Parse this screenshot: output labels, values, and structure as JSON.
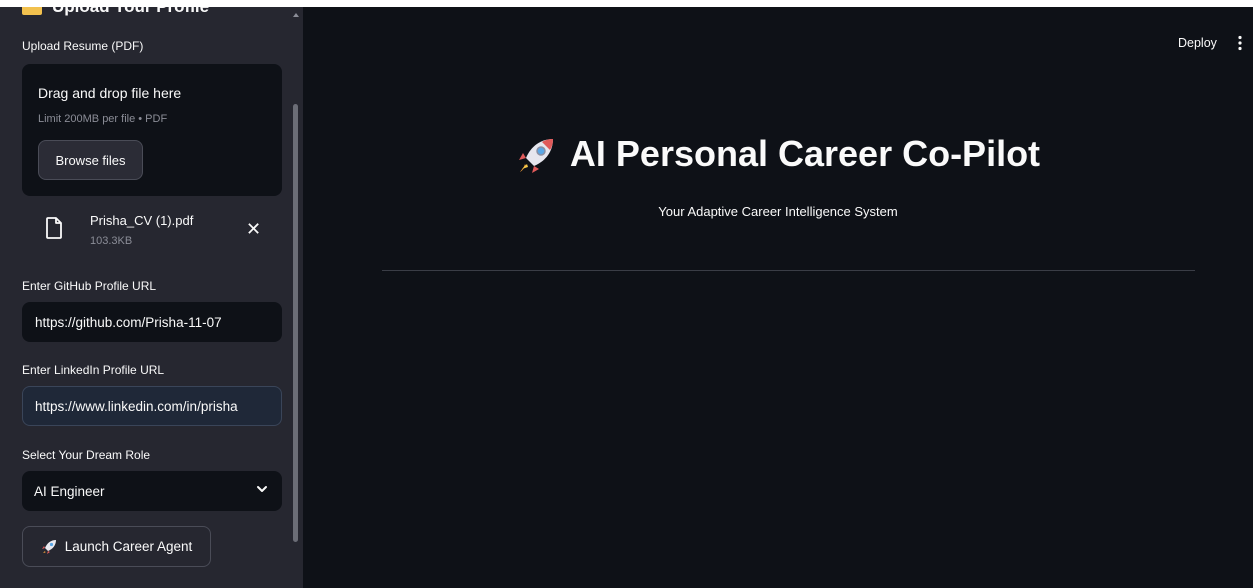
{
  "sidebar": {
    "header": "Upload Your Profile",
    "upload_label": "Upload Resume (PDF)",
    "dropzone": {
      "title": "Drag and drop file here",
      "limit": "Limit 200MB per file • PDF",
      "browse_label": "Browse files"
    },
    "file": {
      "name": "Prisha_CV (1).pdf",
      "size": "103.3KB"
    },
    "github_label": "Enter GitHub Profile URL",
    "github_value": "https://github.com/Prisha-11-07",
    "linkedin_label": "Enter LinkedIn Profile URL",
    "linkedin_value": "https://www.linkedin.com/in/prisha",
    "role_label": "Select Your Dream Role",
    "role_value": "AI Engineer",
    "launch_label": "Launch Career Agent"
  },
  "header": {
    "deploy_label": "Deploy"
  },
  "main": {
    "title": "AI Personal Career Co-Pilot",
    "subtitle": "Your Adaptive Career Intelligence System"
  },
  "colors": {
    "background": "#0e1117",
    "sidebar": "#262730",
    "text": "#fafafa",
    "muted": "#8b8d97"
  }
}
